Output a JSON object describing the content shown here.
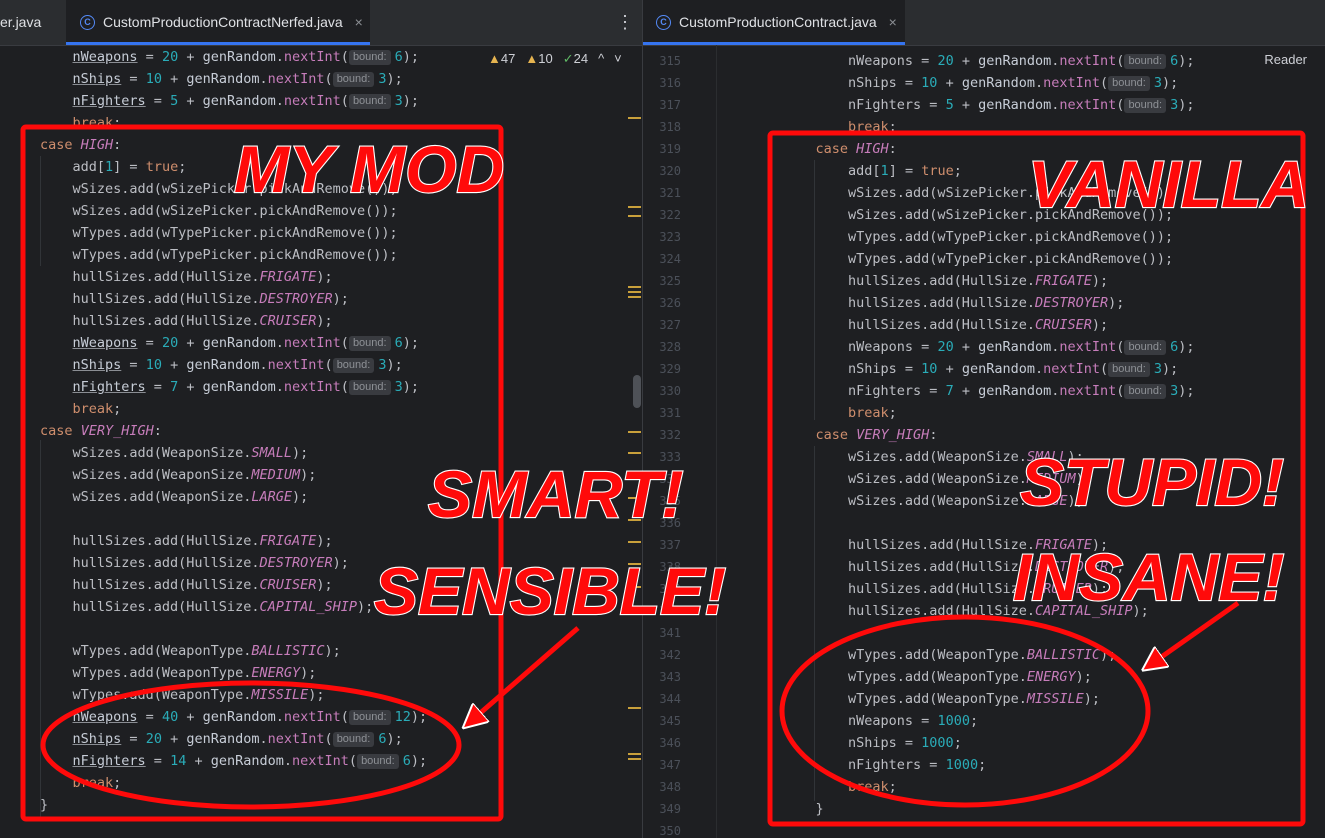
{
  "left_tabs": [
    {
      "label": "er.java",
      "active": false
    },
    {
      "label": "CustomProductionContractNerfed.java",
      "active": true
    }
  ],
  "right_tab": {
    "label": "CustomProductionContract.java"
  },
  "tab_close_glyph": "×",
  "more_glyph": "⋮",
  "file_icon_letter": "C",
  "inspections": {
    "warnings": "47",
    "weak_warnings": "10",
    "typos": "24",
    "warn_glyph": "▲",
    "ok_glyph": "✓",
    "up": "^",
    "down": "˅"
  },
  "reader_label": "Reader",
  "hint_label": "bound:",
  "left_code": [
    [
      [
        "    "
      ],
      [
        "nWeapons",
        "fld ul"
      ],
      [
        " = "
      ],
      [
        "20",
        "num"
      ],
      [
        " + "
      ],
      [
        "genRandom",
        "fld"
      ],
      [
        "."
      ],
      [
        "nextInt",
        "fn"
      ],
      [
        "("
      ],
      [
        "H"
      ],
      [
        "6",
        "num"
      ],
      [
        ");"
      ]
    ],
    [
      [
        "    "
      ],
      [
        "nShips",
        "fld ul"
      ],
      [
        " = "
      ],
      [
        "10",
        "num"
      ],
      [
        " + "
      ],
      [
        "genRandom",
        "fld"
      ],
      [
        "."
      ],
      [
        "nextInt",
        "fn"
      ],
      [
        "("
      ],
      [
        "H"
      ],
      [
        "3",
        "num"
      ],
      [
        ");"
      ]
    ],
    [
      [
        "    "
      ],
      [
        "nFighters",
        "fld ul"
      ],
      [
        " = "
      ],
      [
        "5",
        "num"
      ],
      [
        " + "
      ],
      [
        "genRandom",
        "fld"
      ],
      [
        "."
      ],
      [
        "nextInt",
        "fn"
      ],
      [
        "("
      ],
      [
        "H"
      ],
      [
        "3",
        "num"
      ],
      [
        ");"
      ]
    ],
    [
      [
        "    "
      ],
      [
        "break",
        "kw"
      ],
      [
        ";"
      ]
    ],
    [
      [
        "case ",
        "kw"
      ],
      [
        "HIGH",
        "en"
      ],
      [
        ":"
      ]
    ],
    [
      [
        "    add["
      ],
      [
        "1",
        "num"
      ],
      [
        "] = "
      ],
      [
        "true",
        "kw"
      ],
      [
        ";"
      ]
    ],
    [
      [
        "    wSizes.add(wSizePicker.pickAndRemove());"
      ]
    ],
    [
      [
        "    wSizes.add(wSizePicker.pickAndRemove());"
      ]
    ],
    [
      [
        "    wTypes.add(wTypePicker.pickAndRemove());"
      ]
    ],
    [
      [
        "    wTypes.add(wTypePicker.pickAndRemove());"
      ]
    ],
    [
      [
        "    hullSizes.add(HullSize."
      ],
      [
        "FRIGATE",
        "en"
      ],
      [
        ");"
      ]
    ],
    [
      [
        "    hullSizes.add(HullSize."
      ],
      [
        "DESTROYER",
        "en"
      ],
      [
        ");"
      ]
    ],
    [
      [
        "    hullSizes.add(HullSize."
      ],
      [
        "CRUISER",
        "en"
      ],
      [
        ");"
      ]
    ],
    [
      [
        "    "
      ],
      [
        "nWeapons",
        "fld ul"
      ],
      [
        " = "
      ],
      [
        "20",
        "num"
      ],
      [
        " + "
      ],
      [
        "genRandom",
        "fld"
      ],
      [
        "."
      ],
      [
        "nextInt",
        "fn"
      ],
      [
        "("
      ],
      [
        "H"
      ],
      [
        "6",
        "num"
      ],
      [
        ");"
      ]
    ],
    [
      [
        "    "
      ],
      [
        "nShips",
        "fld ul"
      ],
      [
        " = "
      ],
      [
        "10",
        "num"
      ],
      [
        " + "
      ],
      [
        "genRandom",
        "fld"
      ],
      [
        "."
      ],
      [
        "nextInt",
        "fn"
      ],
      [
        "("
      ],
      [
        "H"
      ],
      [
        "3",
        "num"
      ],
      [
        ");"
      ]
    ],
    [
      [
        "    "
      ],
      [
        "nFighters",
        "fld ul"
      ],
      [
        " = "
      ],
      [
        "7",
        "num"
      ],
      [
        " + "
      ],
      [
        "genRandom",
        "fld"
      ],
      [
        "."
      ],
      [
        "nextInt",
        "fn"
      ],
      [
        "("
      ],
      [
        "H"
      ],
      [
        "3",
        "num"
      ],
      [
        ");"
      ]
    ],
    [
      [
        "    "
      ],
      [
        "break",
        "kw"
      ],
      [
        ";"
      ]
    ],
    [
      [
        "case ",
        "kw"
      ],
      [
        "VERY_HIGH",
        "en"
      ],
      [
        ":"
      ]
    ],
    [
      [
        "    wSizes.add(WeaponSize."
      ],
      [
        "SMALL",
        "en"
      ],
      [
        ");"
      ]
    ],
    [
      [
        "    wSizes.add(WeaponSize."
      ],
      [
        "MEDIUM",
        "en"
      ],
      [
        ");"
      ]
    ],
    [
      [
        "    wSizes.add(WeaponSize."
      ],
      [
        "LARGE",
        "en"
      ],
      [
        ");"
      ]
    ],
    [
      [
        ""
      ]
    ],
    [
      [
        "    hullSizes.add(HullSize."
      ],
      [
        "FRIGATE",
        "en"
      ],
      [
        ");"
      ]
    ],
    [
      [
        "    hullSizes.add(HullSize."
      ],
      [
        "DESTROYER",
        "en"
      ],
      [
        ");"
      ]
    ],
    [
      [
        "    hullSizes.add(HullSize."
      ],
      [
        "CRUISER",
        "en"
      ],
      [
        ");"
      ]
    ],
    [
      [
        "    hullSizes.add(HullSize."
      ],
      [
        "CAPITAL_SHIP",
        "en"
      ],
      [
        ");"
      ]
    ],
    [
      [
        ""
      ]
    ],
    [
      [
        "    wTypes.add(WeaponType."
      ],
      [
        "BALLISTIC",
        "en"
      ],
      [
        ");"
      ]
    ],
    [
      [
        "    wTypes.add(WeaponType."
      ],
      [
        "ENERGY",
        "en"
      ],
      [
        ");"
      ]
    ],
    [
      [
        "    wTypes.add(WeaponType."
      ],
      [
        "MISSILE",
        "en"
      ],
      [
        ");"
      ]
    ],
    [
      [
        "    "
      ],
      [
        "nWeapons",
        "fld ul"
      ],
      [
        " = "
      ],
      [
        "40",
        "num"
      ],
      [
        " + "
      ],
      [
        "genRandom",
        "fld"
      ],
      [
        "."
      ],
      [
        "nextInt",
        "fn"
      ],
      [
        "("
      ],
      [
        "H"
      ],
      [
        "12",
        "num"
      ],
      [
        ");"
      ]
    ],
    [
      [
        "    "
      ],
      [
        "nShips",
        "fld ul"
      ],
      [
        " = "
      ],
      [
        "20",
        "num"
      ],
      [
        " + "
      ],
      [
        "genRandom",
        "fld"
      ],
      [
        "."
      ],
      [
        "nextInt",
        "fn"
      ],
      [
        "("
      ],
      [
        "H"
      ],
      [
        "6",
        "num"
      ],
      [
        ");"
      ]
    ],
    [
      [
        "    "
      ],
      [
        "nFighters",
        "fld ul"
      ],
      [
        " = "
      ],
      [
        "14",
        "num"
      ],
      [
        " + "
      ],
      [
        "genRandom",
        "fld"
      ],
      [
        "."
      ],
      [
        "nextInt",
        "fn"
      ],
      [
        "("
      ],
      [
        "H"
      ],
      [
        "6",
        "num"
      ],
      [
        ");"
      ]
    ],
    [
      [
        "    "
      ],
      [
        "break",
        "kw"
      ],
      [
        ";"
      ]
    ],
    [
      [
        "}"
      ]
    ]
  ],
  "right_line_numbers": [
    "315",
    "316",
    "317",
    "318",
    "319",
    "320",
    "321",
    "322",
    "323",
    "324",
    "325",
    "326",
    "327",
    "328",
    "329",
    "330",
    "331",
    "332",
    "333",
    "334",
    "335",
    "336",
    "337",
    "338",
    "339",
    "340",
    "341",
    "342",
    "343",
    "344",
    "345",
    "346",
    "347",
    "348",
    "349",
    "350"
  ],
  "right_code": [
    [
      [
        "        nWeapons = "
      ],
      [
        "20",
        "num"
      ],
      [
        " + "
      ],
      [
        "genRandom",
        "fld"
      ],
      [
        "."
      ],
      [
        "nextInt",
        "fn"
      ],
      [
        "("
      ],
      [
        "H"
      ],
      [
        "6",
        "num"
      ],
      [
        ");"
      ]
    ],
    [
      [
        "        nShips = "
      ],
      [
        "10",
        "num"
      ],
      [
        " + "
      ],
      [
        "genRandom",
        "fld"
      ],
      [
        "."
      ],
      [
        "nextInt",
        "fn"
      ],
      [
        "("
      ],
      [
        "H"
      ],
      [
        "3",
        "num"
      ],
      [
        ");"
      ]
    ],
    [
      [
        "        nFighters = "
      ],
      [
        "5",
        "num"
      ],
      [
        " + "
      ],
      [
        "genRandom",
        "fld"
      ],
      [
        "."
      ],
      [
        "nextInt",
        "fn"
      ],
      [
        "("
      ],
      [
        "H"
      ],
      [
        "3",
        "num"
      ],
      [
        ");"
      ]
    ],
    [
      [
        "        "
      ],
      [
        "break",
        "kw"
      ],
      [
        ";"
      ]
    ],
    [
      [
        "    "
      ],
      [
        "case ",
        "kw"
      ],
      [
        "HIGH",
        "en"
      ],
      [
        ":"
      ]
    ],
    [
      [
        "        add["
      ],
      [
        "1",
        "num"
      ],
      [
        "] = "
      ],
      [
        "true",
        "kw"
      ],
      [
        ";"
      ]
    ],
    [
      [
        "        wSizes.add(wSizePicker.pickAndRemove());"
      ]
    ],
    [
      [
        "        wSizes.add(wSizePicker.pickAndRemove());"
      ]
    ],
    [
      [
        "        wTypes.add(wTypePicker.pickAndRemove());"
      ]
    ],
    [
      [
        "        wTypes.add(wTypePicker.pickAndRemove());"
      ]
    ],
    [
      [
        "        hullSizes.add(HullSize."
      ],
      [
        "FRIGATE",
        "en"
      ],
      [
        ");"
      ]
    ],
    [
      [
        "        hullSizes.add(HullSize."
      ],
      [
        "DESTROYER",
        "en"
      ],
      [
        ");"
      ]
    ],
    [
      [
        "        hullSizes.add(HullSize."
      ],
      [
        "CRUISER",
        "en"
      ],
      [
        ");"
      ]
    ],
    [
      [
        "        nWeapons = "
      ],
      [
        "20",
        "num"
      ],
      [
        " + "
      ],
      [
        "genRandom",
        "fld"
      ],
      [
        "."
      ],
      [
        "nextInt",
        "fn"
      ],
      [
        "("
      ],
      [
        "H"
      ],
      [
        "6",
        "num"
      ],
      [
        ");"
      ]
    ],
    [
      [
        "        nShips = "
      ],
      [
        "10",
        "num"
      ],
      [
        " + "
      ],
      [
        "genRandom",
        "fld"
      ],
      [
        "."
      ],
      [
        "nextInt",
        "fn"
      ],
      [
        "("
      ],
      [
        "H"
      ],
      [
        "3",
        "num"
      ],
      [
        ");"
      ]
    ],
    [
      [
        "        nFighters = "
      ],
      [
        "7",
        "num"
      ],
      [
        " + "
      ],
      [
        "genRandom",
        "fld"
      ],
      [
        "."
      ],
      [
        "nextInt",
        "fn"
      ],
      [
        "("
      ],
      [
        "H"
      ],
      [
        "3",
        "num"
      ],
      [
        ");"
      ]
    ],
    [
      [
        "        "
      ],
      [
        "break",
        "kw"
      ],
      [
        ";"
      ]
    ],
    [
      [
        "    "
      ],
      [
        "case ",
        "kw"
      ],
      [
        "VERY_HIGH",
        "en"
      ],
      [
        ":"
      ]
    ],
    [
      [
        "        wSizes.add(WeaponSize."
      ],
      [
        "SMALL",
        "en"
      ],
      [
        ");"
      ]
    ],
    [
      [
        "        wSizes.add(WeaponSize."
      ],
      [
        "MEDIUM",
        "en"
      ],
      [
        ");"
      ]
    ],
    [
      [
        "        wSizes.add(WeaponSize."
      ],
      [
        "LARGE",
        "en"
      ],
      [
        ");"
      ]
    ],
    [
      [
        ""
      ]
    ],
    [
      [
        "        hullSizes.add(HullSize."
      ],
      [
        "FRIGATE",
        "en"
      ],
      [
        ");"
      ]
    ],
    [
      [
        "        hullSizes.add(HullSize."
      ],
      [
        "DESTROYER",
        "en"
      ],
      [
        ");"
      ]
    ],
    [
      [
        "        hullSizes.add(HullSize."
      ],
      [
        "CRUISER",
        "en"
      ],
      [
        ");"
      ]
    ],
    [
      [
        "        hullSizes.add(HullSize."
      ],
      [
        "CAPITAL_SHIP",
        "en"
      ],
      [
        ");"
      ]
    ],
    [
      [
        ""
      ]
    ],
    [
      [
        "        wTypes.add(WeaponType."
      ],
      [
        "BALLISTIC",
        "en"
      ],
      [
        ");"
      ]
    ],
    [
      [
        "        wTypes.add(WeaponType."
      ],
      [
        "ENERGY",
        "en"
      ],
      [
        ");"
      ]
    ],
    [
      [
        "        wTypes.add(WeaponType."
      ],
      [
        "MISSILE",
        "en"
      ],
      [
        ");"
      ]
    ],
    [
      [
        "        nWeapons = "
      ],
      [
        "1000",
        "num"
      ],
      [
        ";"
      ]
    ],
    [
      [
        "        nShips = "
      ],
      [
        "1000",
        "num"
      ],
      [
        ";"
      ]
    ],
    [
      [
        "        nFighters = "
      ],
      [
        "1000",
        "num"
      ],
      [
        ";"
      ]
    ],
    [
      [
        "        "
      ],
      [
        "break",
        "kw"
      ],
      [
        ";"
      ]
    ],
    [
      [
        "    }"
      ]
    ],
    [
      [
        ""
      ]
    ]
  ],
  "annotations": {
    "left_title": "MY MOD",
    "left_word_1": "SMART!",
    "left_word_2": "SENSIBLE!",
    "right_title": "VANILLA",
    "right_word_1": "STUPID!",
    "right_word_2": "INSANE!",
    "color": "#ff0a0a"
  }
}
